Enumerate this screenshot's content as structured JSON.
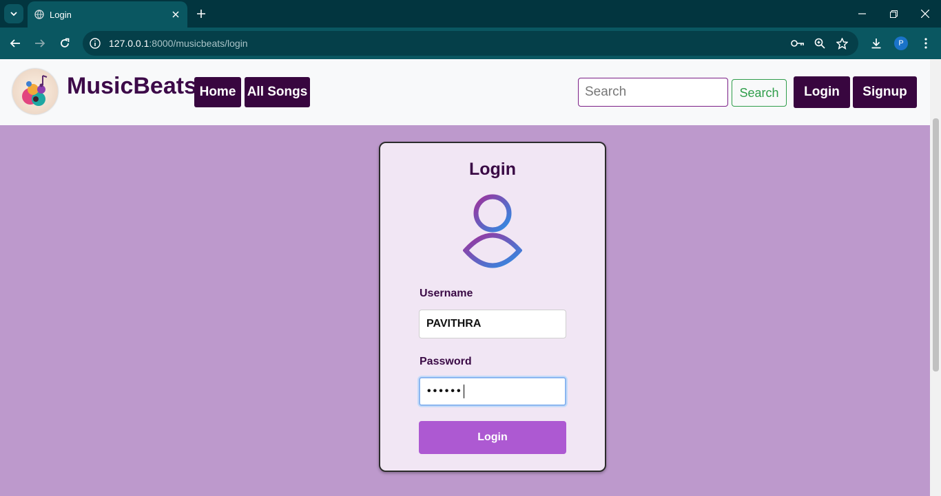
{
  "browser": {
    "tab_title": "Login",
    "url_host": "127.0.0.1",
    "url_rest": ":8000/musicbeats/login",
    "profile_initial": "P"
  },
  "navbar": {
    "brand": "MusicBeats",
    "links": [
      "Home",
      "All Songs"
    ],
    "search_placeholder": "Search",
    "search_button": "Search",
    "login_button": "Login",
    "signup_button": "Signup"
  },
  "login_card": {
    "title": "Login",
    "username_label": "Username",
    "username_value": "PAVITHRA",
    "password_label": "Password",
    "password_masked": "••••••",
    "submit_label": "Login"
  },
  "colors": {
    "page_bg": "#bd99cc",
    "brand": "#3d0a49",
    "nav_button": "#38063f",
    "submit_button": "#ad59d2",
    "search_button": "#2e9d4a"
  }
}
